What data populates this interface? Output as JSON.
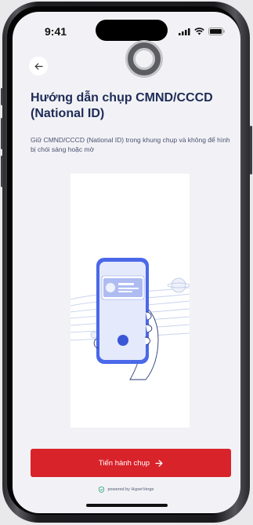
{
  "status_bar": {
    "time": "9:41",
    "icons": [
      "cellular-signal-icon",
      "wifi-icon",
      "battery-icon"
    ]
  },
  "nav": {
    "back_icon": "arrow-left-icon",
    "loading_icon": "loading-spinner-icon"
  },
  "content": {
    "title": "Hướng dẫn chụp CMND/CCCD (National ID)",
    "subtitle": "Giữ CMND/CCCD (National ID) trong khung chụp và không để hình bị chói sáng hoặc mờ",
    "illustration_icon": "phone-scanning-id-card-illustration"
  },
  "cta": {
    "label": "Tiến hành chụp",
    "icon": "arrow-right-icon"
  },
  "footer": {
    "powered_by": "powered by HyperVerge",
    "icon": "shield-check-icon"
  },
  "colors": {
    "primary": "#d8232a",
    "title": "#1e2b56",
    "accent": "#4a68e8",
    "background": "#f2f2f6"
  }
}
